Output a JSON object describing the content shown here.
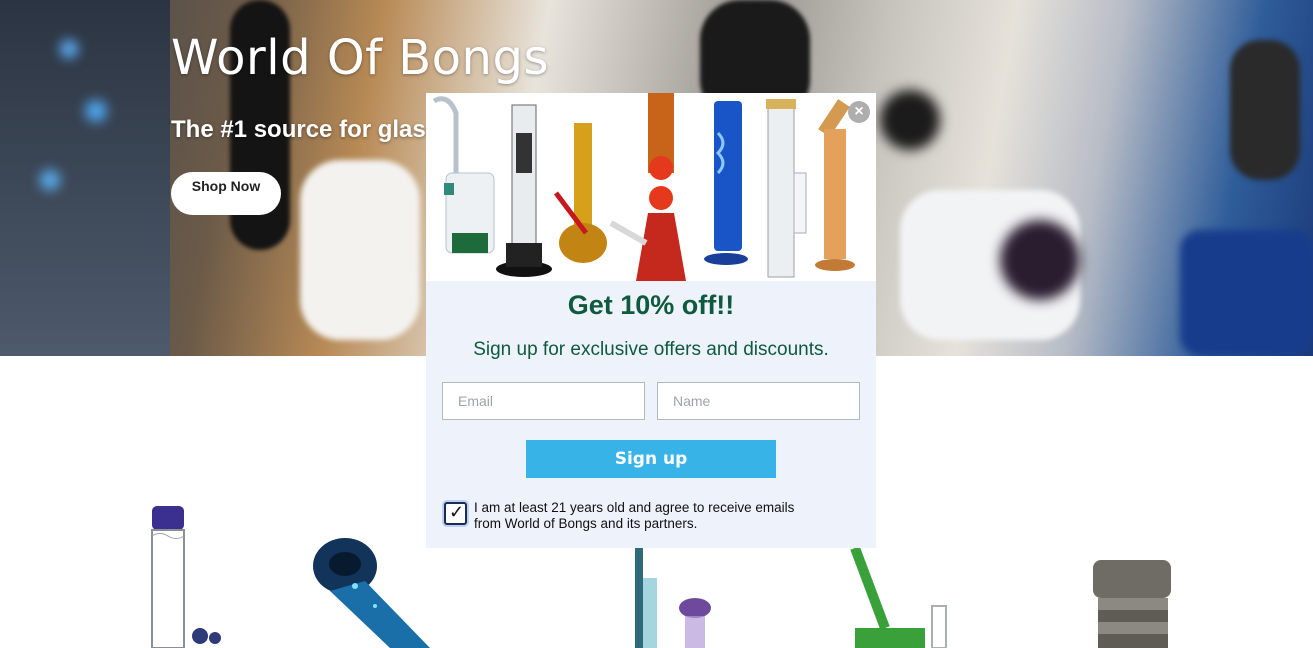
{
  "hero": {
    "title": "World Of Bongs",
    "subtitle": "The #1 source for glass and accessories",
    "shop_button": "Shop Now"
  },
  "popup": {
    "close_label": "×",
    "headline": "Get 10% off!!",
    "subheadline": "Sign up for exclusive offers and discounts.",
    "email_placeholder": "Email",
    "name_placeholder": "Name",
    "signup_button": "Sign up",
    "consent_checked": true,
    "consent_check_glyph": "✓",
    "consent_text": "I am at least 21 years old and agree to receive emails from World of Bongs and its partners."
  },
  "colors": {
    "headline": "#0e5a3c",
    "signup_button": "#38b3e8",
    "popup_background": "#eef2fb"
  }
}
